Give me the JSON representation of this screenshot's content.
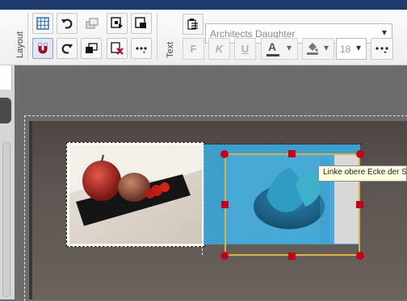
{
  "ribbon": {
    "groups": {
      "layout_label": "Layout",
      "text_label": "Text"
    },
    "font_name": "Architects Daughter",
    "font_size": "18",
    "format_buttons": {
      "bold": "F",
      "italic": "K",
      "underline": "U",
      "font_color": "A"
    }
  },
  "canvas": {
    "tooltip": "Linke obere Ecke der S"
  },
  "colors": {
    "title_bar": "#1f3a6d",
    "selection_overlay": "#3aa7d8",
    "handle": "#c4001b",
    "selection_frame": "#d8b14a"
  },
  "icons": {
    "grid": "grid-icon",
    "undo": "undo-icon",
    "redo": "redo-icon",
    "magnet": "magnet-icon",
    "bring_front": "bring-to-front-icon",
    "send_back": "send-to-back-icon",
    "delete": "delete-icon",
    "more": "more-icon",
    "paste_format": "paste-format-icon"
  }
}
